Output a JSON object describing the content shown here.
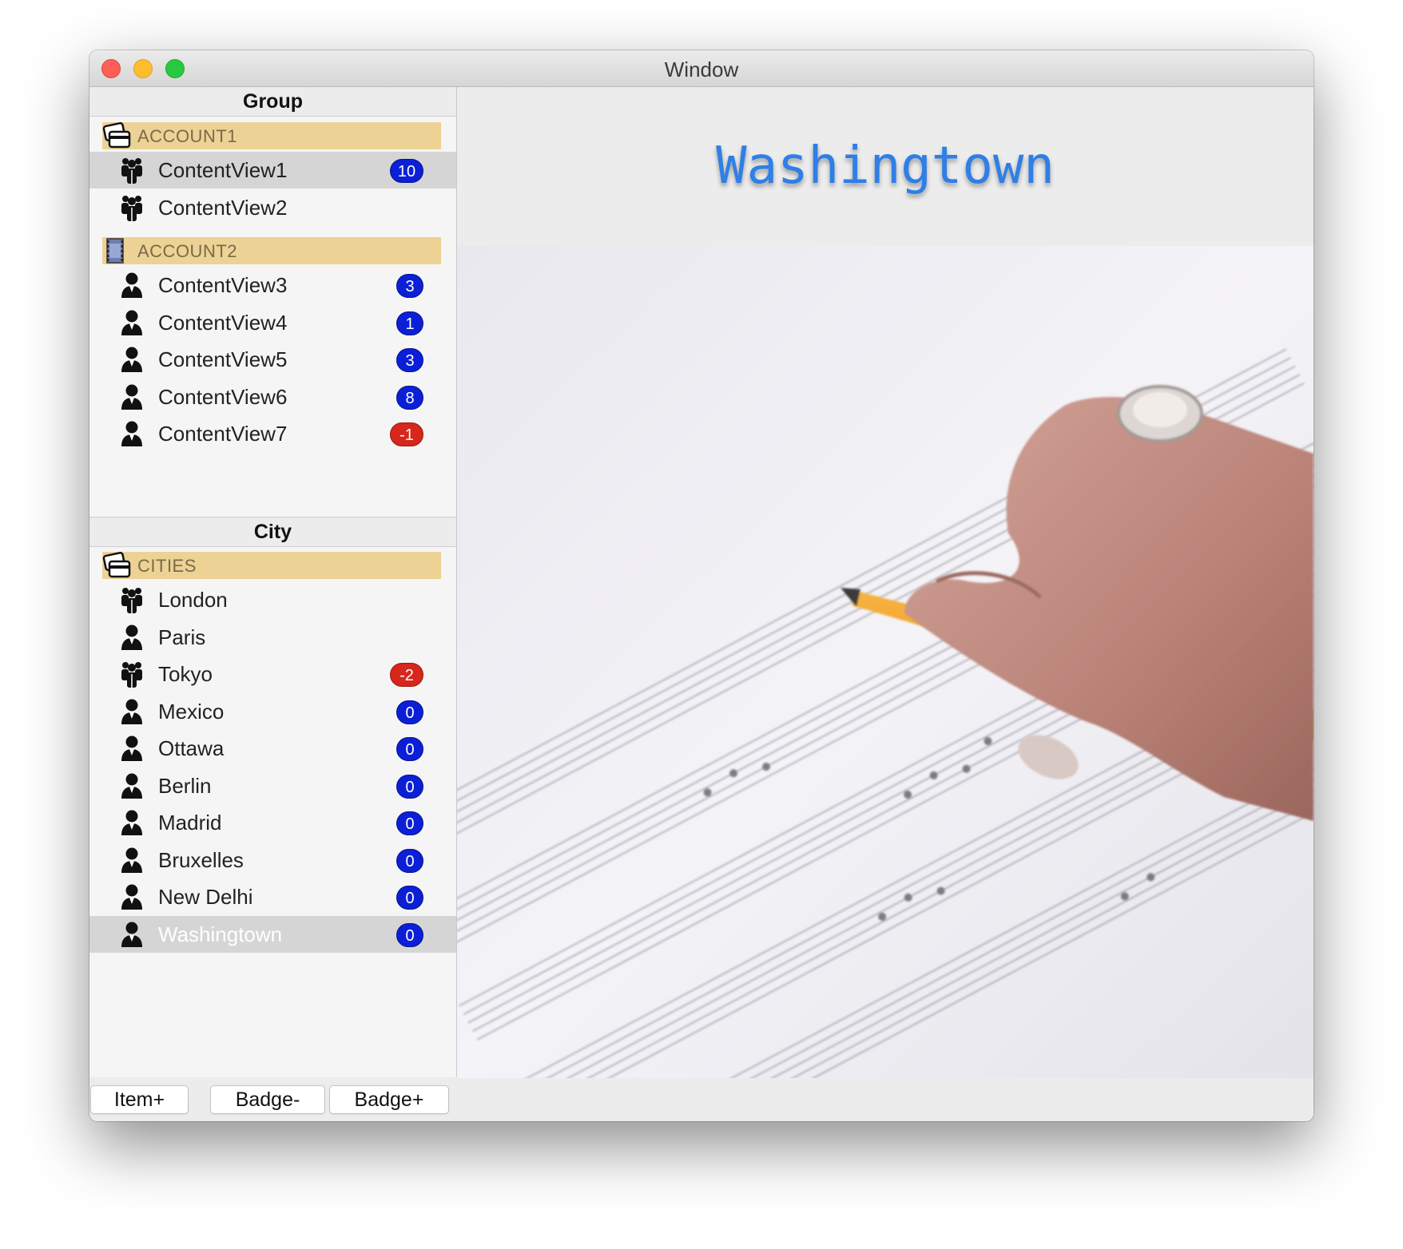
{
  "window": {
    "title": "Window"
  },
  "group_panel": {
    "header": "Group",
    "groups": [
      {
        "label": "ACCOUNT1",
        "icon": "cards-icon",
        "items": [
          {
            "label": "ContentView1",
            "icon": "people-icon",
            "badge": "10",
            "badge_color": "#0b20d6",
            "selected": true
          },
          {
            "label": "ContentView2",
            "icon": "people-icon",
            "badge": null
          }
        ]
      },
      {
        "label": "ACCOUNT2",
        "icon": "film-icon",
        "items": [
          {
            "label": "ContentView3",
            "icon": "person-icon",
            "badge": "3",
            "badge_color": "#0b20d6"
          },
          {
            "label": "ContentView4",
            "icon": "person-icon",
            "badge": "1",
            "badge_color": "#0b20d6"
          },
          {
            "label": "ContentView5",
            "icon": "person-icon",
            "badge": "3",
            "badge_color": "#0b20d6"
          },
          {
            "label": "ContentView6",
            "icon": "person-icon",
            "badge": "8",
            "badge_color": "#0b20d6"
          },
          {
            "label": "ContentView7",
            "icon": "person-icon",
            "badge": "-1",
            "badge_color": "#d7261c"
          }
        ]
      }
    ]
  },
  "city_panel": {
    "header": "City",
    "group": {
      "label": "CITIES",
      "icon": "cards-icon"
    },
    "items": [
      {
        "label": "London",
        "icon": "people-icon",
        "badge": null
      },
      {
        "label": "Paris",
        "icon": "person-icon",
        "badge": null
      },
      {
        "label": "Tokyo",
        "icon": "people-icon",
        "badge": "-2",
        "badge_color": "#d7261c"
      },
      {
        "label": "Mexico",
        "icon": "person-icon",
        "badge": "0",
        "badge_color": "#0b20d6"
      },
      {
        "label": "Ottawa",
        "icon": "person-icon",
        "badge": "0",
        "badge_color": "#0b20d6"
      },
      {
        "label": "Berlin",
        "icon": "person-icon",
        "badge": "0",
        "badge_color": "#0b20d6"
      },
      {
        "label": "Madrid",
        "icon": "person-icon",
        "badge": "0",
        "badge_color": "#0b20d6"
      },
      {
        "label": "Bruxelles",
        "icon": "person-icon",
        "badge": "0",
        "badge_color": "#0b20d6"
      },
      {
        "label": "New Delhi",
        "icon": "person-icon",
        "badge": "0",
        "badge_color": "#0b20d6"
      },
      {
        "label": "Washingtown",
        "icon": "person-icon",
        "badge": "0",
        "badge_color": "#0b20d6",
        "selected": true
      }
    ]
  },
  "toolbar": {
    "item_plus": "Item+",
    "badge_minus": "Badge-",
    "badge_plus": "Badge+"
  },
  "detail": {
    "title": "Washingtown",
    "title_color": "#2e7fe6",
    "image": "sheet-music-with-hand-and-pencil"
  }
}
